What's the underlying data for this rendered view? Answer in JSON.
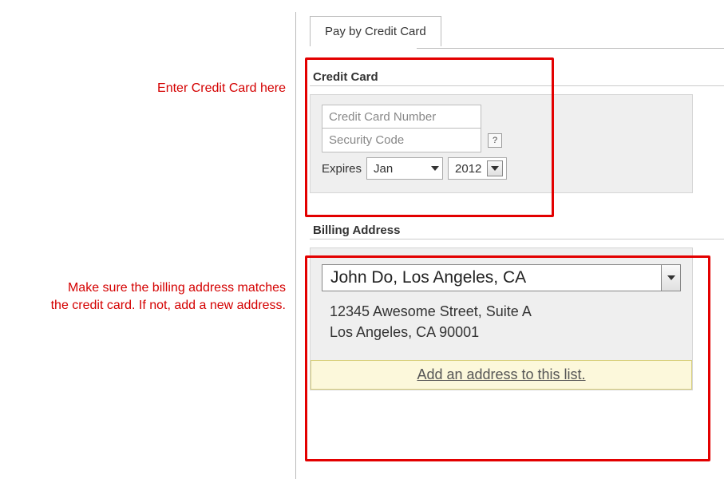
{
  "annotations": {
    "credit_card": "Enter Credit Card here",
    "billing": "Make sure the billing address matches\nthe credit card. If not, add a new address."
  },
  "tab": {
    "label": "Pay by Credit Card"
  },
  "credit_card": {
    "section_title": "Credit Card",
    "number_placeholder": "Credit Card Number",
    "security_placeholder": "Security Code",
    "help_symbol": "?",
    "expires_label": "Expires",
    "month_value": "Jan",
    "year_value": "2012"
  },
  "billing": {
    "section_title": "Billing Address",
    "address_selected": "John Do, Los Angeles, CA",
    "address_line1": "12345 Awesome Street, Suite A",
    "address_line2": "Los Angeles, CA 90001",
    "add_link": "Add an address to this list."
  }
}
